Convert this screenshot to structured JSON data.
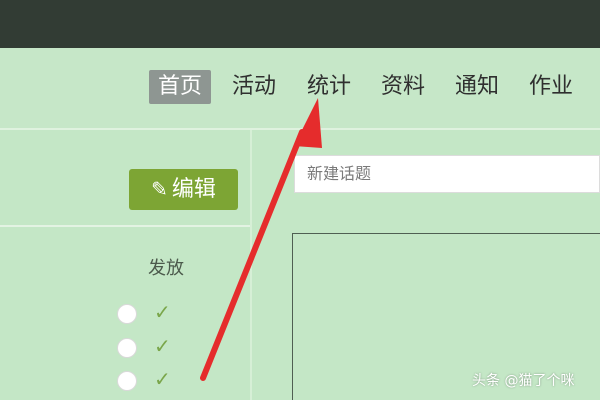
{
  "nav": {
    "items": [
      {
        "label": "首页",
        "active": true
      },
      {
        "label": "活动",
        "active": false
      },
      {
        "label": "统计",
        "active": false
      },
      {
        "label": "资料",
        "active": false
      },
      {
        "label": "通知",
        "active": false
      },
      {
        "label": "作业",
        "active": false
      }
    ]
  },
  "toolbar": {
    "edit_label": "编辑",
    "edit_icon": "pencil-icon"
  },
  "table": {
    "column_header": "发放",
    "rows": [
      {
        "radio": "empty",
        "status": "✓"
      },
      {
        "radio": "empty",
        "status": "✓"
      },
      {
        "radio": "empty",
        "status": "✓"
      }
    ]
  },
  "topic": {
    "placeholder": "新建话题"
  },
  "watermark": "头条 @猫了个咪",
  "colors": {
    "topbar": "#323c34",
    "background": "#c4e7c6",
    "active_tab": "#8e9692",
    "edit_button": "#7da534",
    "arrow": "#e52c2c"
  }
}
